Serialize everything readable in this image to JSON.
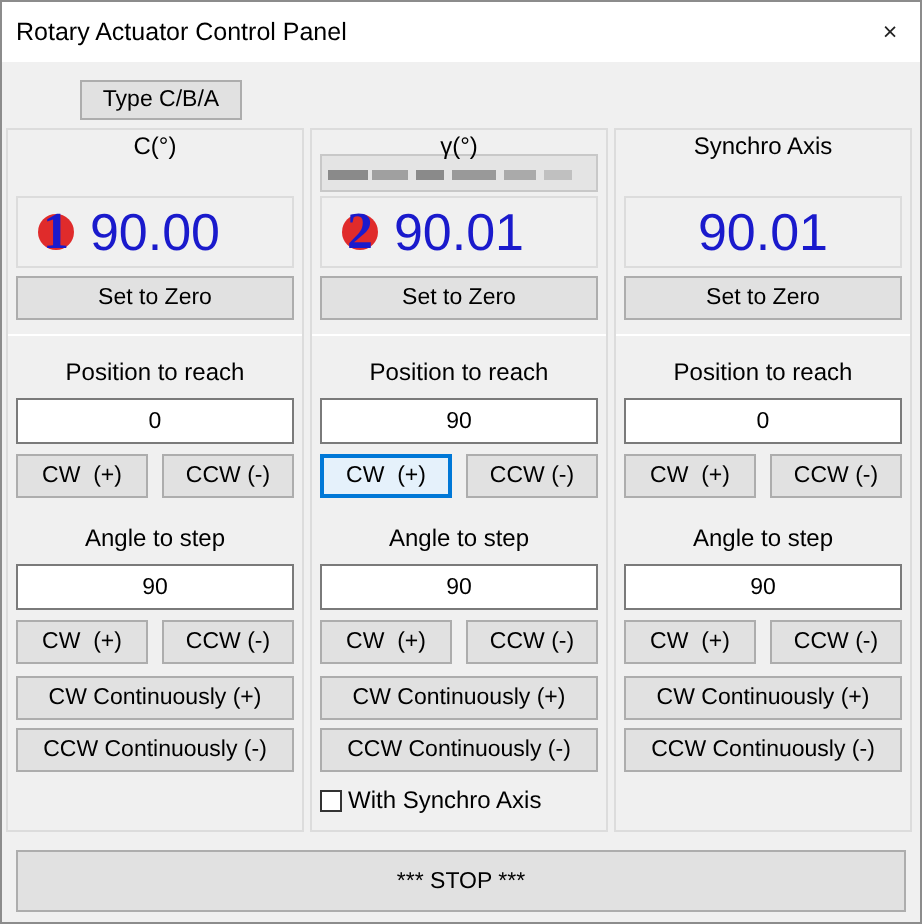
{
  "window": {
    "title": "Rotary Actuator Control Panel",
    "close": "×"
  },
  "type_button": {
    "label": "Type C/B/A"
  },
  "columns": [
    {
      "header": "C(°)",
      "obscured_field": false,
      "badge": {
        "text": "1",
        "color": "#e02b2b"
      },
      "reading": "90.00",
      "zero_button": "Set to Zero",
      "position_label": "Position to reach",
      "position_value": "0",
      "move_buttons": [
        {
          "label": "CW  (+)",
          "focused": false
        },
        {
          "label": "CCW (-)",
          "focused": false
        }
      ],
      "angle_label": "Angle to step",
      "angle_value": "90",
      "step_buttons": [
        {
          "label": "CW  (+)",
          "focused": false
        },
        {
          "label": "CCW (-)",
          "focused": false
        }
      ],
      "continuous_buttons": [
        "CW Continuously (+)",
        "CCW Continuously (-)"
      ]
    },
    {
      "header": "γ(°)",
      "obscured_field": true,
      "badge": {
        "text": "2",
        "color": "#e02b2b"
      },
      "reading": "90.01",
      "zero_button": "Set to Zero",
      "position_label": "Position to reach",
      "position_value": "90",
      "move_buttons": [
        {
          "label": "CW  (+)",
          "focused": true
        },
        {
          "label": "CCW (-)",
          "focused": false
        }
      ],
      "angle_label": "Angle to step",
      "angle_value": "90",
      "step_buttons": [
        {
          "label": "CW  (+)",
          "focused": false
        },
        {
          "label": "CCW (-)",
          "focused": false
        }
      ],
      "continuous_buttons": [
        "CW Continuously (+)",
        "CCW Continuously (-)"
      ],
      "checkbox": {
        "label": "With Synchro Axis",
        "checked": false
      }
    },
    {
      "header": "Synchro Axis",
      "obscured_field": false,
      "reading": "90.01",
      "zero_button": "Set to Zero",
      "position_label": "Position to reach",
      "position_value": "0",
      "move_buttons": [
        {
          "label": "CW  (+)",
          "focused": false
        },
        {
          "label": "CCW (-)",
          "focused": false
        }
      ],
      "angle_label": "Angle to step",
      "angle_value": "90",
      "step_buttons": [
        {
          "label": "CW  (+)",
          "focused": false
        },
        {
          "label": "CCW (-)",
          "focused": false
        }
      ],
      "continuous_buttons": [
        "CW Continuously (+)",
        "CCW Continuously (-)"
      ]
    }
  ],
  "stop_button": {
    "label": "*** STOP ***"
  }
}
